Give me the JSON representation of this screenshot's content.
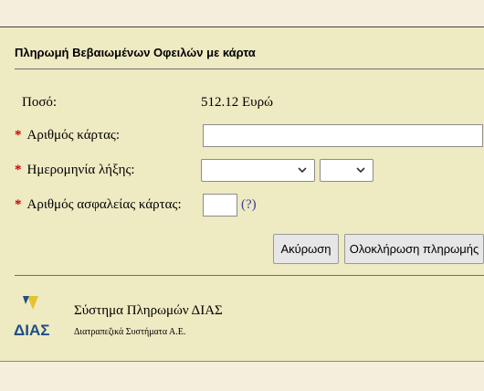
{
  "form": {
    "title": "Πληρωμή Βεβαιωμένων Οφειλών με κάρτα",
    "amount_label": "Ποσό:",
    "amount_value": "512.12 Ευρώ",
    "required_mark": "*",
    "card_number_label": "Αριθμός κάρτας:",
    "card_number_value": "",
    "expiry_label": "Ημερομηνία λήξης:",
    "expiry_month_value": "",
    "expiry_year_value": "",
    "cvv_label": "Αριθμός ασφαλείας κάρτας:",
    "cvv_value": "",
    "help_link": "(?)"
  },
  "buttons": {
    "cancel": "Ακύρωση",
    "complete": "Ολοκλήρωση πληρωμής"
  },
  "footer": {
    "logo_text": "ΔΙΑΣ",
    "system_name": "Σύστημα Πληρωμών ΔΙΑΣ",
    "company": "Διατραπεζικά Συστήματα Α.Ε."
  },
  "colors": {
    "panel_bg": "#eeeac2",
    "page_bg": "#f4eedc",
    "required": "#cc0000",
    "logo_blue": "#1f4e87",
    "logo_yellow": "#e6c22e"
  }
}
